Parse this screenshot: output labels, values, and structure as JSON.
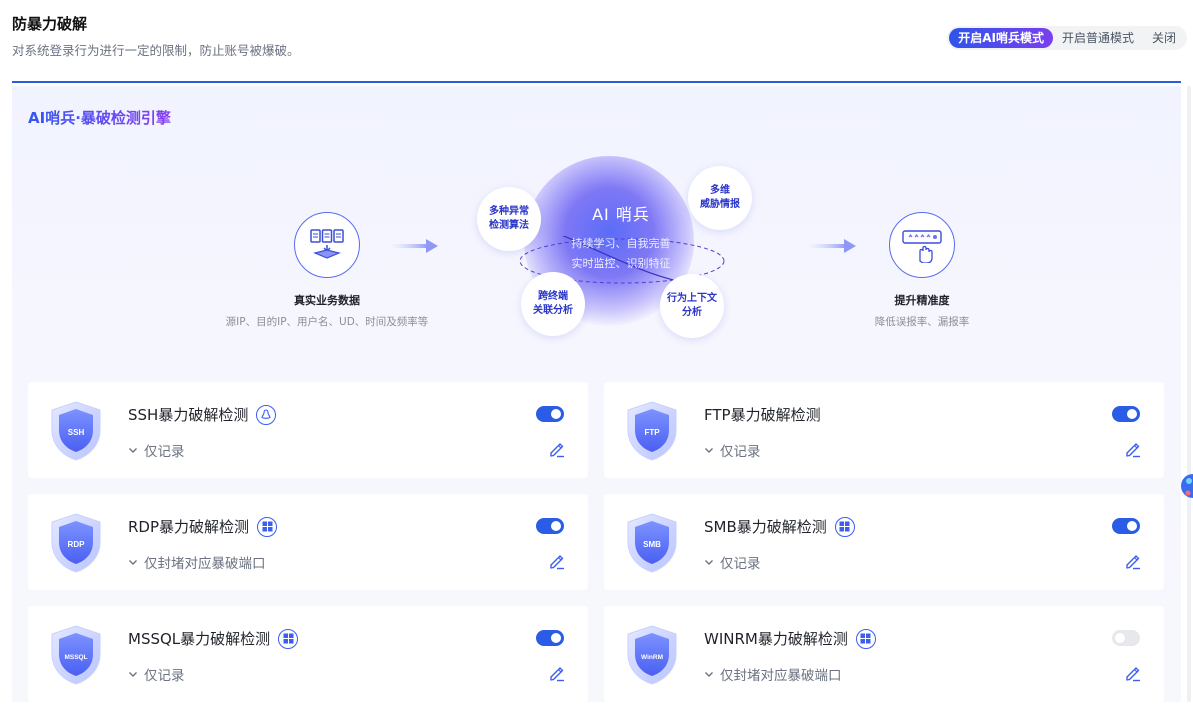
{
  "header": {
    "title": "防暴力破解",
    "subtitle": "对系统登录行为进行一定的限制，防止账号被爆破。"
  },
  "mode_switch": {
    "options": [
      "开启AI哨兵模式",
      "开启普通模式",
      "关闭"
    ],
    "selected": "开启AI哨兵模式"
  },
  "engine": {
    "title": "AI哨兵·暴破检测引擎",
    "input": {
      "label": "真实业务数据",
      "sub": "源IP、目的IP、用户名、UD、时间及频率等"
    },
    "core": {
      "title": "AI 哨兵",
      "line1": "持续学习、自我完善",
      "line2": "实时监控、识别特征",
      "bubbles": [
        "多种异常\n检测算法",
        "多维\n威胁情报",
        "跨终端\n关联分析",
        "行为上下文\n分析"
      ]
    },
    "output": {
      "label": "提升精准度",
      "sub": "降低误报率、漏报率"
    }
  },
  "cards": [
    {
      "id": "ssh",
      "shield": "SSH",
      "title": "SSH暴力破解检测",
      "os_icon": "linux-icon",
      "mode": "仅记录",
      "enabled": true
    },
    {
      "id": "ftp",
      "shield": "FTP",
      "title": "FTP暴力破解检测",
      "os_icon": "",
      "mode": "仅记录",
      "enabled": true
    },
    {
      "id": "rdp",
      "shield": "RDP",
      "title": "RDP暴力破解检测",
      "os_icon": "windows-icon",
      "mode": "仅封堵对应暴破端口",
      "enabled": true
    },
    {
      "id": "smb",
      "shield": "SMB",
      "title": "SMB暴力破解检测",
      "os_icon": "windows-icon",
      "mode": "仅记录",
      "enabled": true
    },
    {
      "id": "mssql",
      "shield": "MSSQL",
      "title": "MSSQL暴力破解检测",
      "os_icon": "windows-icon",
      "mode": "仅记录",
      "enabled": true
    },
    {
      "id": "winrm",
      "shield": "WinRM",
      "title": "WINRM暴力破解检测",
      "os_icon": "windows-icon",
      "mode": "仅封堵对应暴破端口",
      "enabled": false
    }
  ],
  "colors": {
    "accent": "#2b5ce6",
    "accent_purple": "#7a3ff0",
    "toggle_off": "#e6e8ec"
  }
}
